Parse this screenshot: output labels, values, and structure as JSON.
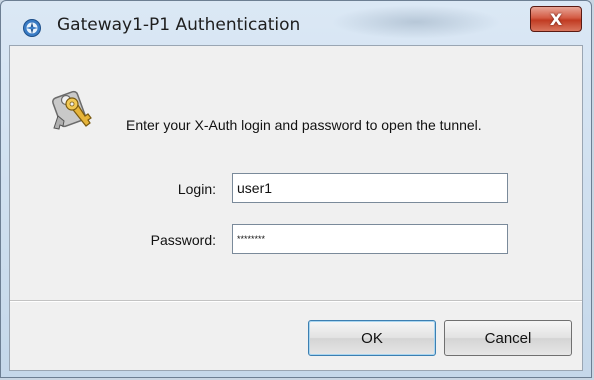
{
  "window": {
    "title": "Gateway1-P1 Authentication",
    "close_glyph": "X",
    "accent_color": "#c13b22"
  },
  "dialog": {
    "icon": "keys-icon",
    "prompt": "Enter your X-Auth login and password to open the tunnel.",
    "login_label": "Login:",
    "login_value": "user1",
    "password_label": "Password:",
    "password_value": "********"
  },
  "buttons": {
    "ok_label": "OK",
    "cancel_label": "Cancel"
  }
}
